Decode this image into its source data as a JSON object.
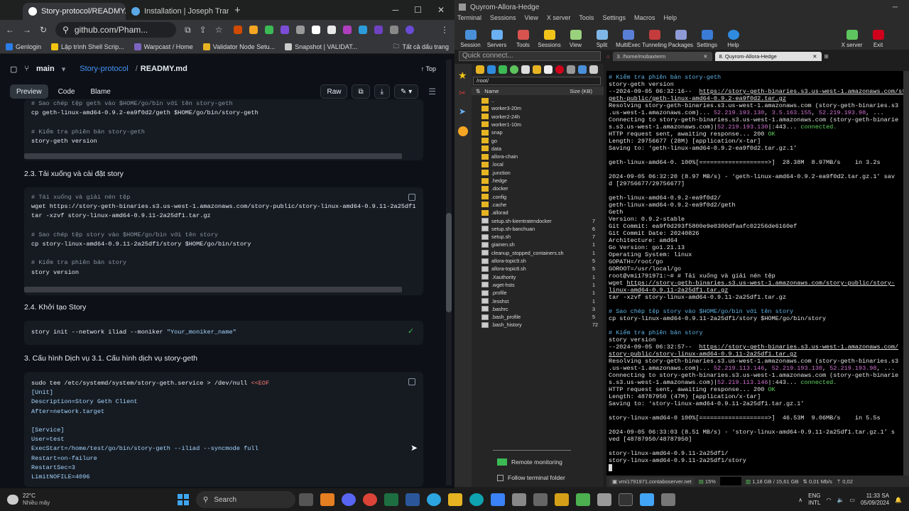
{
  "browser": {
    "tabs": [
      {
        "title": "Story-protocol/READMY.md at",
        "color": "#ffffff"
      },
      {
        "title": "Installation | Joseph Tran Servic",
        "color": "#5aa9e6"
      }
    ],
    "new_tab": "+",
    "url": "github.com/Pham...",
    "bookmarks": [
      "Genlogin",
      "Lập trình Shell Scrip...",
      "Warpcast / Home",
      "Validator Node Setu...",
      "Snapshot | VALIDAT...",
      "Tất cả dấu trang"
    ],
    "branch": "main",
    "repo": "Story-protocol",
    "file": "READMY.md",
    "top": "Top",
    "view_tabs": [
      "Preview",
      "Code",
      "Blame"
    ],
    "raw": "Raw",
    "code1": [
      "# Sao chép tệp geth vào $HOME/go/bin với tên story-geth",
      "cp geth-linux-amd64-0.9.2-ea9f0d2/geth $HOME/go/bin/story-geth",
      "",
      "# Kiểm tra phiên bản story-geth",
      "story-geth version"
    ],
    "h1": "2.3. Tải xuống và cài đặt story",
    "code2": [
      "# Tải xuống và giải nén tệp",
      "wget https://story-geth-binaries.s3.us-west-1.amazonaws.com/story-public/story-linux-amd64-0.9.11-2a25df1",
      "tar -xzvf story-linux-amd64-0.9.11-2a25df1.tar.gz",
      "",
      "# Sao chép tệp story vào $HOME/go/bin với tên story",
      "cp story-linux-amd64-0.9.11-2a25df1/story $HOME/go/bin/story",
      "",
      "# Kiểm tra phiên bản story",
      "story version"
    ],
    "h2": "2.4. Khởi tạo Story",
    "code3_cmd": "story init --network iliad --moniker ",
    "code3_str": "\"Your_moniker_name\"",
    "h3": "3. Cấu hình Dịch vụ 3.1. Cấu hình dịch vụ story-geth",
    "code4_a": "sudo tee /etc/systemd/system/story-geth.service > /dev/null ",
    "code4_eof": "<<EOF",
    "code4": [
      "[Unit]",
      "Description=Story Geth Client",
      "After=network.target",
      "",
      "[Service]",
      "User=test",
      "ExecStart=/home/test/go/bin/story-geth --iliad --syncmode full",
      "Restart=on-failure",
      "RestartSec=3",
      "LimitNOFILE=4096"
    ]
  },
  "moba": {
    "title": "Quyrom-Allora-Hedge",
    "menu": [
      "Terminal",
      "Sessions",
      "View",
      "X server",
      "Tools",
      "Settings",
      "Macros",
      "Help"
    ],
    "toolbar": [
      "Session",
      "Servers",
      "Tools",
      "Sessions",
      "View",
      "Split",
      "MultiExec",
      "Tunneling",
      "Packages",
      "Settings",
      "Help",
      "X server",
      "Exit"
    ],
    "quick_connect": "Quick connect...",
    "path": "/root/",
    "col_name": "Name",
    "col_size": "Size (KB)",
    "files": [
      {
        "n": "..",
        "s": "",
        "t": "folder"
      },
      {
        "n": "worker3-20m",
        "s": "",
        "t": "folder"
      },
      {
        "n": "worker2-24h",
        "s": "",
        "t": "folder"
      },
      {
        "n": "worker1-10m",
        "s": "",
        "t": "folder"
      },
      {
        "n": "snap",
        "s": "",
        "t": "folder"
      },
      {
        "n": "go",
        "s": "",
        "t": "folder"
      },
      {
        "n": "data",
        "s": "",
        "t": "folder"
      },
      {
        "n": "allora-chain",
        "s": "",
        "t": "folder"
      },
      {
        "n": ".local",
        "s": "",
        "t": "folder"
      },
      {
        "n": ".junction",
        "s": "",
        "t": "folder"
      },
      {
        "n": ".hedge",
        "s": "",
        "t": "folder"
      },
      {
        "n": ".docker",
        "s": "",
        "t": "folder"
      },
      {
        "n": ".config",
        "s": "",
        "t": "folder"
      },
      {
        "n": ".cache",
        "s": "",
        "t": "folder"
      },
      {
        "n": ".allorad",
        "s": "",
        "t": "folder"
      },
      {
        "n": "setup.sh-kiemtratendocker",
        "s": "7",
        "t": "file"
      },
      {
        "n": "setup.sh-banchuan",
        "s": "6",
        "t": "file"
      },
      {
        "n": "setup.sh",
        "s": "7",
        "t": "file"
      },
      {
        "n": "giainen.sh",
        "s": "1",
        "t": "file"
      },
      {
        "n": "cleanup_stopped_containers.sh",
        "s": "1",
        "t": "file"
      },
      {
        "n": "allora-topic9.sh",
        "s": "5",
        "t": "file"
      },
      {
        "n": "allora-topic8.sh",
        "s": "5",
        "t": "file"
      },
      {
        "n": ".Xauthority",
        "s": "1",
        "t": "file"
      },
      {
        "n": ".wget-hsts",
        "s": "1",
        "t": "file"
      },
      {
        "n": ".profile",
        "s": "1",
        "t": "file"
      },
      {
        "n": ".lesshst",
        "s": "1",
        "t": "file"
      },
      {
        "n": ".bashrc",
        "s": "3",
        "t": "file"
      },
      {
        "n": ".bash_profile",
        "s": "5",
        "t": "file"
      },
      {
        "n": ".bash_history",
        "s": "72",
        "t": "file"
      }
    ],
    "remote_monitoring": "Remote monitoring",
    "follow_folder": "Follow terminal folder",
    "tabs": [
      "3. /home/mobaxterm",
      "8. Quyrom-Allora-Hedge"
    ],
    "status": [
      "vmi1791971.contaboserver.net",
      "15%",
      "1,18 GB / 15,61 GB",
      "0,01 Mb/s",
      "0,02"
    ]
  },
  "taskbar": {
    "weather_temp": "22°C",
    "weather_desc": "Nhiều mây",
    "search": "Search",
    "lang1": "ENG",
    "lang2": "INTL",
    "time": "11:33 SA",
    "date": "05/09/2024"
  }
}
